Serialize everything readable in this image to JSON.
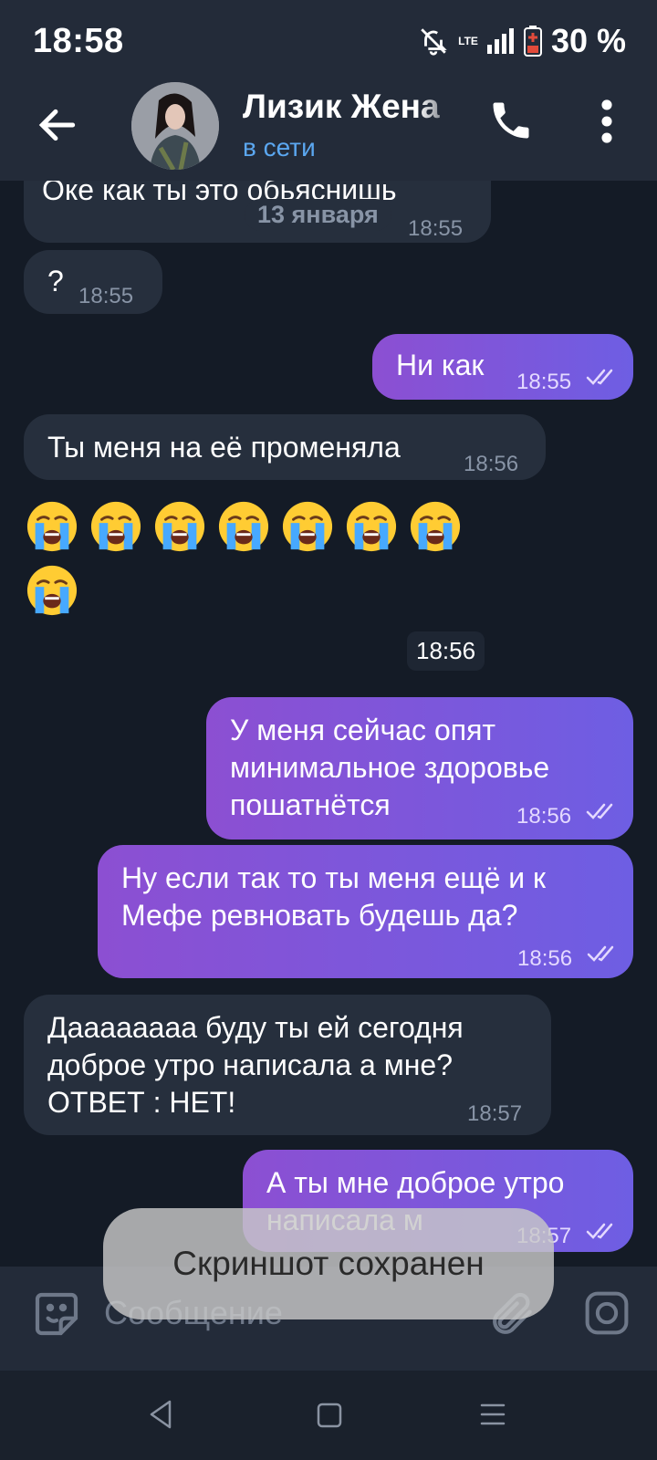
{
  "status_bar": {
    "time": "18:58",
    "network": "LTE",
    "battery": "30 %"
  },
  "header": {
    "contact_name": "Лизик Жена",
    "status": "в сети"
  },
  "messages": [
    {
      "dir": "in",
      "text": "Оке как ты это обьяснишь",
      "time": "18:55"
    },
    {
      "dir": "in",
      "text": "?",
      "time": "18:55"
    },
    {
      "dir": "out",
      "text": "Ни как",
      "time": "18:55"
    },
    {
      "dir": "in",
      "text": "Ты меня на её променяла",
      "time": "18:56"
    },
    {
      "dir": "in",
      "text": "😭😭😭😭😭😭😭😭",
      "time": "18:56"
    },
    {
      "dir": "out",
      "text": "У меня сейчас опят минимальное здоровье пошатнётся",
      "time": "18:56"
    },
    {
      "dir": "out",
      "text": "Ну если так то ты меня ещё и к Мефе ревновать будешь да?",
      "time": "18:56"
    },
    {
      "dir": "in",
      "text": "Даааааааа буду ты ей сегодня доброе утро написала а мне? ОТВЕТ : НЕТ!",
      "time": "18:57"
    },
    {
      "dir": "out",
      "text": "А ты мне доброе утро написала м",
      "time": "18:57"
    }
  ],
  "date_pill": "13 января",
  "toast": "Скриншот сохранен",
  "composer": {
    "placeholder": "Сообщение"
  },
  "colors": {
    "background": "#141b26",
    "bar": "#232b39",
    "incoming": "#262f3d",
    "outgoing_start": "#8c4fd2",
    "outgoing_end": "#6e5ee3",
    "online": "#5ba7f0"
  }
}
